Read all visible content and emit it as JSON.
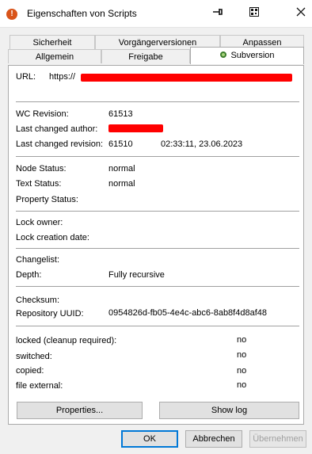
{
  "window": {
    "title": "Eigenschaften von Scripts",
    "app_icon": "tortoisesvn-icon",
    "controls": [
      "pin-icon",
      "qr-icon",
      "close-icon"
    ]
  },
  "tabs": {
    "row1": [
      "Sicherheit",
      "Vorgängerversionen",
      "Anpassen"
    ],
    "row2": [
      "Allgemein",
      "Freigabe",
      "Subversion"
    ],
    "active": "Subversion"
  },
  "info": {
    "url_label": "URL:",
    "url_value": "https://",
    "wc_revision_label": "WC Revision:",
    "wc_revision_value": "61513",
    "last_author_label": "Last changed author:",
    "last_revision_label": "Last changed revision:",
    "last_revision_value": "61510",
    "last_revision_time": "02:33:11, 23.06.2023",
    "node_status_label": "Node Status:",
    "node_status_value": "normal",
    "text_status_label": "Text Status:",
    "text_status_value": "normal",
    "property_status_label": "Property Status:",
    "lock_owner_label": "Lock owner:",
    "lock_date_label": "Lock creation date:",
    "changelist_label": "Changelist:",
    "depth_label": "Depth:",
    "depth_value": "Fully recursive",
    "checksum_label": "Checksum:",
    "uuid_label": "Repository UUID:",
    "uuid_value": "0954826d-fb05-4e4c-abc6-8ab8f4d8af48",
    "locked_label": "locked (cleanup required):",
    "locked_value": "no",
    "switched_label": "switched:",
    "switched_value": "no",
    "copied_label": "copied:",
    "copied_value": "no",
    "external_label": "file external:",
    "external_value": "no"
  },
  "panel_buttons": {
    "properties": "Properties...",
    "showlog": "Show log"
  },
  "dialog_buttons": {
    "ok": "OK",
    "cancel": "Abbrechen",
    "apply": "Übernehmen"
  },
  "colors": {
    "redaction": "#ff0000",
    "focus_border": "#0078d7"
  }
}
